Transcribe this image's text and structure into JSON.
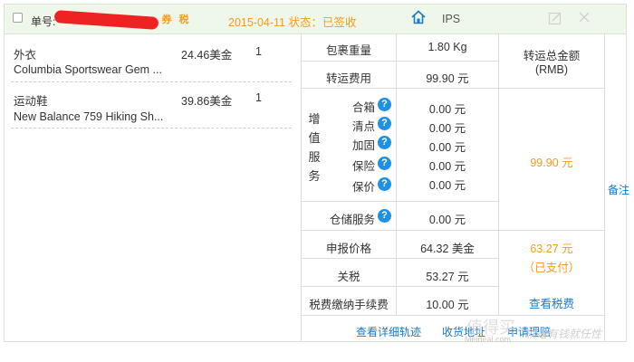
{
  "header": {
    "order_label": "单号:",
    "coupon_tag": "券",
    "tax_tag": "税",
    "date_status": "2015-04-11 状态：已签收",
    "warehouse": "IPS"
  },
  "items": [
    {
      "category": "外衣",
      "name": "Columbia Sportswear Gem ...",
      "price": "24.46美金",
      "qty": "1"
    },
    {
      "category": "运动鞋",
      "name": "New Balance 759 Hiking Sh...",
      "price": "39.86美金",
      "qty": "1"
    }
  ],
  "shipping": {
    "weight_label": "包裹重量",
    "weight_value": "1.80 Kg",
    "fee_label": "转运费用",
    "fee_value": "99.90 元",
    "total_label_1": "转运总金额",
    "total_label_2": "(RMB)",
    "total_value": "99.90 元"
  },
  "value_added": {
    "group_chars": [
      "增",
      "值",
      "服",
      "务"
    ],
    "items": [
      {
        "label": "合箱",
        "value": "0.00 元"
      },
      {
        "label": "清点",
        "value": "0.00 元"
      },
      {
        "label": "加固",
        "value": "0.00 元"
      },
      {
        "label": "保险",
        "value": "0.00 元"
      },
      {
        "label": "保价",
        "value": "0.00 元"
      }
    ],
    "storage_label": "仓储服务",
    "storage_value": "0.00 元"
  },
  "tax": {
    "declared_label": "申报价格",
    "declared_value": "64.32 美金",
    "duty_label": "关税",
    "duty_value": "53.27 元",
    "fee_label": "税费缴纳手续费",
    "fee_value": "10.00 元",
    "total_value": "63.27 元",
    "paid_status": "（已支付）",
    "view_tax": "查看税费"
  },
  "side_note": "备注",
  "footer": {
    "track": "查看详细轨迹",
    "address": "收货地址",
    "claim": "申请理赔"
  },
  "watermark": "值得买",
  "watermark_sub": "Meideal.com",
  "watermark_right": "就是有钱就任性"
}
